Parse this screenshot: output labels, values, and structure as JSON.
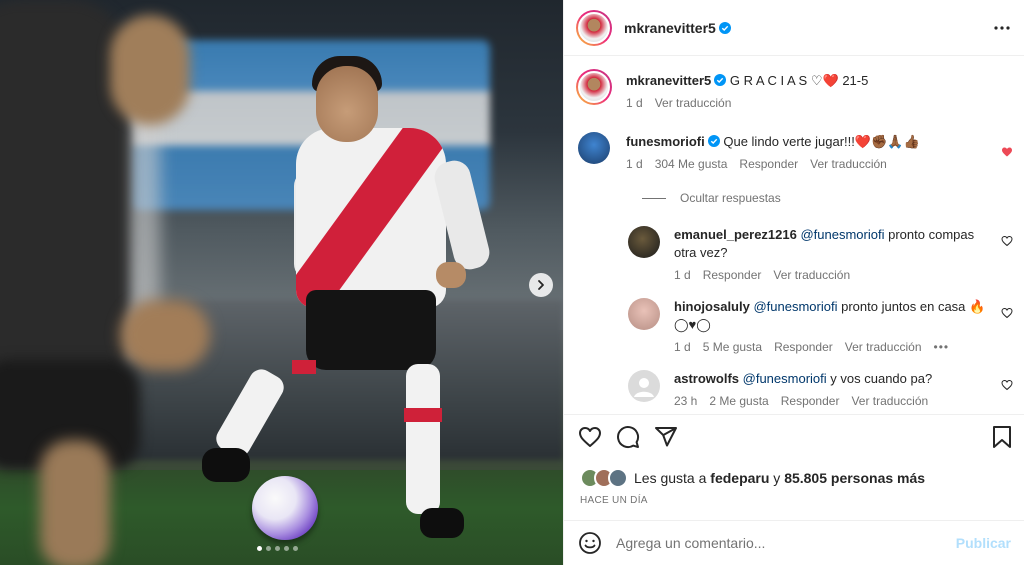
{
  "post": {
    "username": "mkranevitter5",
    "more_icon": "more-horizontal-icon",
    "caption": {
      "username": "mkranevitter5",
      "text": "G R A C I A S",
      "emoji_heart_white": "♡",
      "emoji_heart_red": "❤️",
      "suffix": "21-5",
      "time": "1 d",
      "translate": "Ver traducción"
    },
    "carousel": {
      "dots": 5,
      "active_index": 0
    }
  },
  "comments": [
    {
      "username": "funesmoriofi",
      "verified": true,
      "text": "Que lindo verte jugar!!!",
      "emoji": "❤️✊🏾🙏🏾👍🏾",
      "time": "1 d",
      "likes": "304 Me gusta",
      "reply": "Responder",
      "translate": "Ver traducción",
      "liked": true
    }
  ],
  "hide_replies": "Ocultar respuestas",
  "replies": [
    {
      "username": "emanuel_perez1216",
      "mention": "@funesmoriofi",
      "text": "pronto compas otra vez?",
      "time": "1 d",
      "likes": "",
      "reply": "Responder",
      "translate": "Ver traducción"
    },
    {
      "username": "hinojosaluly",
      "mention": "@funesmoriofi",
      "text": "pronto juntos en casa",
      "emoji": "🔥",
      "emoji_line2": "◯♥◯",
      "time": "1 d",
      "likes": "5 Me gusta",
      "reply": "Responder",
      "translate": "Ver traducción"
    },
    {
      "username": "astrowolfs",
      "mention": "@funesmoriofi",
      "text": "y vos cuando pa?",
      "time": "23 h",
      "likes": "2 Me gusta",
      "reply": "Responder",
      "translate": "Ver traducción"
    }
  ],
  "likes_line": {
    "prefix": "Les gusta a",
    "user": "fedeparu",
    "connector": "y",
    "count": "85.805 personas más"
  },
  "time_ago": "HACE UN DÍA",
  "composer": {
    "placeholder": "Agrega un comentario...",
    "post_label": "Publicar"
  },
  "colors": {
    "verified": "#0095f6",
    "heart_red": "#ed4956",
    "mention": "#00376b",
    "post_disabled": "#b2dffc"
  }
}
